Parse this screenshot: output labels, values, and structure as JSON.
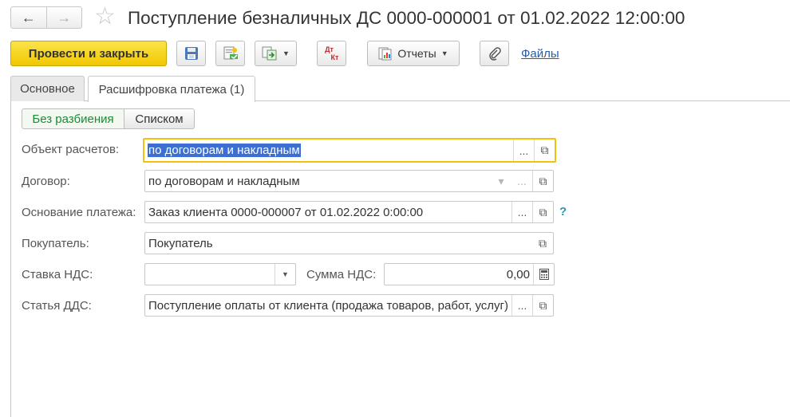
{
  "title": "Поступление безналичных ДС 0000-000001 от 01.02.2022 12:00:00",
  "nav": {
    "back_icon": "arrow-left-icon",
    "forward_icon": "arrow-right-icon",
    "star_icon": "star-icon"
  },
  "toolbar": {
    "post_close_label": "Провести и закрыть",
    "reports_label": "Отчеты",
    "files_label": "Файлы",
    "dt_label": "Дт",
    "kt_label": "Кт"
  },
  "tabs": [
    {
      "label": "Основное",
      "active": false
    },
    {
      "label": "Расшифровка платежа (1)",
      "active": true
    }
  ],
  "segmented": {
    "option1": "Без разбиения",
    "option2": "Списком"
  },
  "form": {
    "object_label": "Объект расчетов:",
    "object_value": "по договорам и накладным",
    "contract_label": "Договор:",
    "contract_value": "по договорам и накладным",
    "basis_label": "Основание платежа:",
    "basis_value": "Заказ клиента 0000-000007 от 01.02.2022 0:00:00",
    "buyer_label": "Покупатель:",
    "buyer_value": "Покупатель",
    "vat_rate_label": "Ставка НДС:",
    "vat_rate_value": "",
    "vat_sum_label": "Сумма НДС:",
    "vat_sum_value": "0,00",
    "cashflow_label": "Статья ДДС:",
    "cashflow_value": "Поступление оплаты от клиента (продажа товаров, работ, услуг)",
    "help_mark": "?",
    "ellipsis": "...",
    "dropdown_arrow": "▾"
  },
  "colors": {
    "primary_button": "#f6d21e",
    "focus_border": "#f2c20f",
    "link": "#2a5da8",
    "active_segment": "#1b8a36",
    "selection": "#3c6fd1"
  }
}
